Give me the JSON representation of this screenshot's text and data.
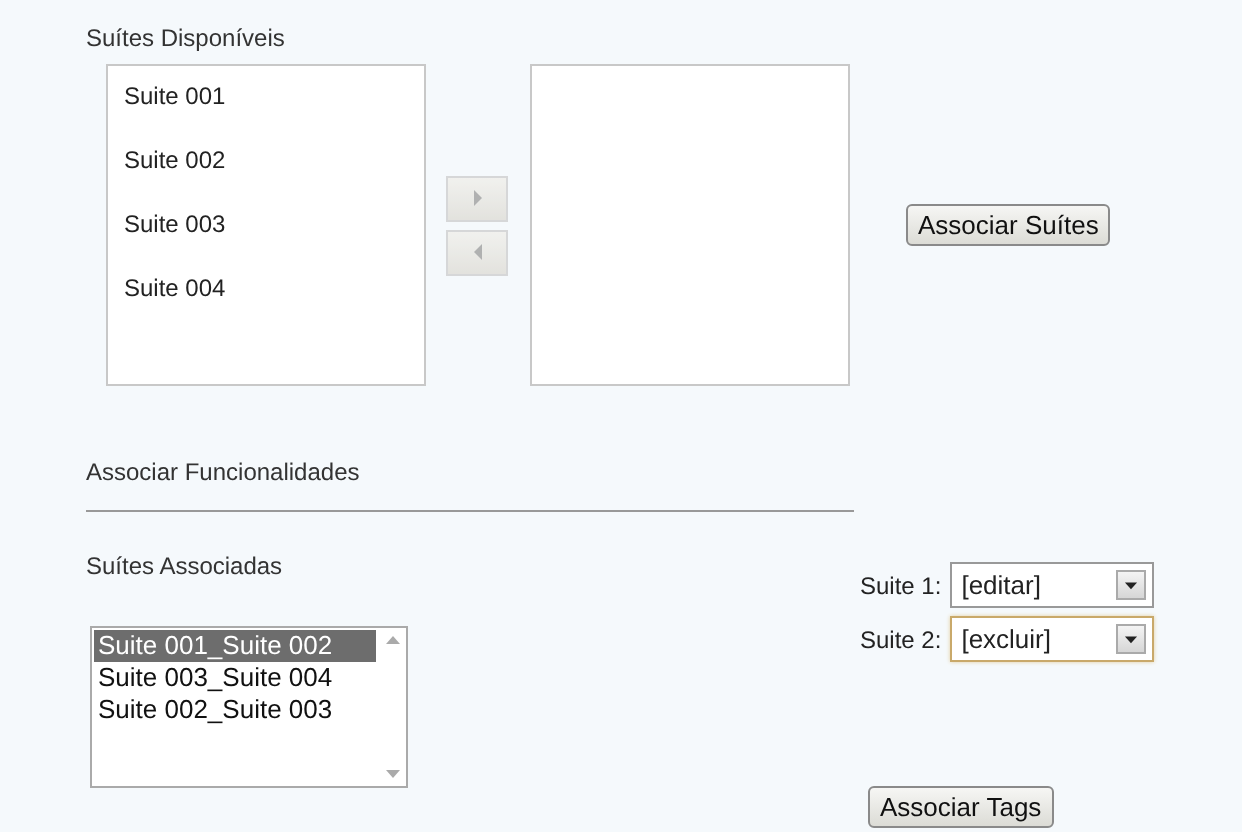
{
  "available": {
    "title": "Suítes Disponíveis",
    "items": [
      {
        "label": "Suite 001",
        "selected": false
      },
      {
        "label": "Suite 002",
        "selected": false
      },
      {
        "label": "Suite 003",
        "selected": false
      },
      {
        "label": "Suite 004",
        "selected": false
      }
    ],
    "move_buttons": [
      {
        "kind": "right",
        "disabled": true
      },
      {
        "kind": "left",
        "disabled": true
      }
    ],
    "button": "Associar Suítes"
  },
  "functionality": {
    "title": "Associar Funcionalidades",
    "subtitle": "Suítes Associadas",
    "items": [
      {
        "label": "Suite 001_Suite 002",
        "selected": true
      },
      {
        "label": "Suite 003_Suite 004",
        "selected": false
      },
      {
        "label": "Suite 002_Suite 003",
        "selected": false
      }
    ],
    "selects": [
      {
        "label": "Suite 1:",
        "value": "[editar]",
        "focused": false
      },
      {
        "label": "Suite 2:",
        "value": "[excluir]",
        "focused": true
      }
    ],
    "button": "Associar Tags"
  }
}
